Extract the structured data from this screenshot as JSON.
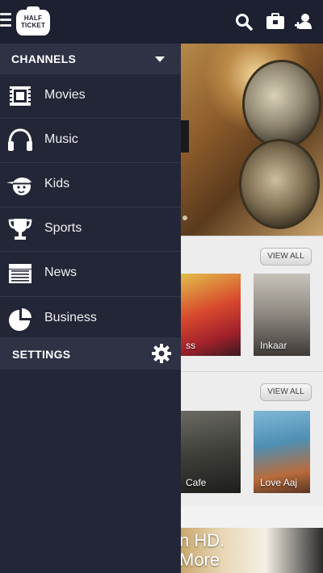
{
  "logo": {
    "line1": "HALF",
    "line2": "TICKET"
  },
  "icons": {
    "menu": "hamburger-icon",
    "search": "search-icon",
    "briefcase": "briefcase-icon",
    "profile": "user-icon"
  },
  "drawer": {
    "channels_label": "CHANNELS",
    "items": [
      {
        "label": "Movies",
        "icon": "film-icon"
      },
      {
        "label": "Music",
        "icon": "headphones-icon"
      },
      {
        "label": "Kids",
        "icon": "kid-face-icon"
      },
      {
        "label": "Sports",
        "icon": "trophy-icon"
      },
      {
        "label": "News",
        "icon": "newspaper-icon"
      },
      {
        "label": "Business",
        "icon": "pie-chart-icon"
      }
    ],
    "settings_label": "SETTINGS"
  },
  "content": {
    "sections": [
      {
        "view_all_label": "VIEW ALL",
        "posters": [
          {
            "caption": "ss"
          },
          {
            "caption": "Inkaar"
          }
        ]
      },
      {
        "view_all_label": "VIEW ALL",
        "posters": [
          {
            "caption": "Cafe"
          },
          {
            "caption": "Love Aaj"
          }
        ]
      }
    ],
    "bottom_banner_text": "n HD.\nMore"
  },
  "colors": {
    "topbar": "#1d2030",
    "drawer_bg": "#232636",
    "drawer_header": "#2e3244",
    "text_light": "#f0f0f2"
  }
}
